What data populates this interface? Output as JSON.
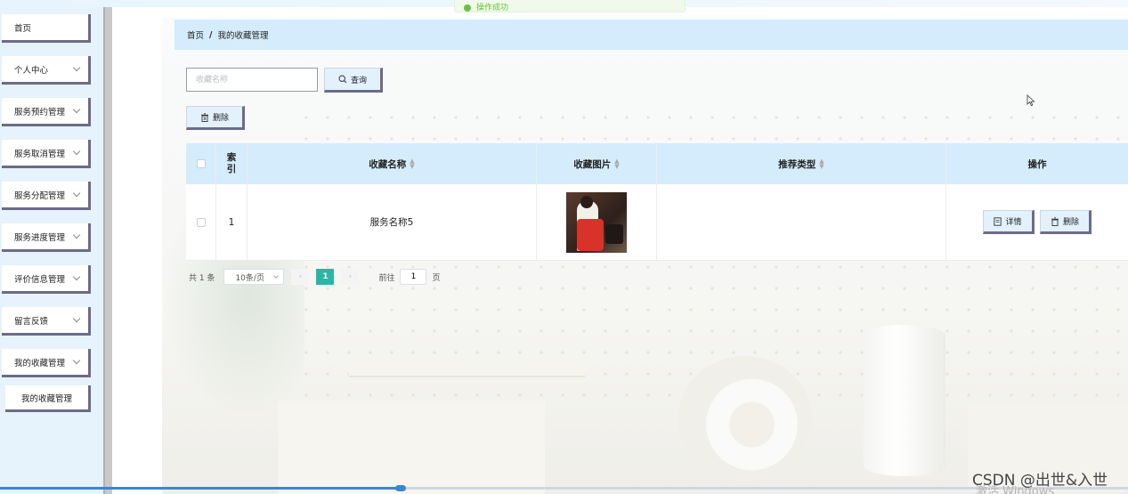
{
  "toast": {
    "text": "操作成功"
  },
  "sidebar": {
    "items": [
      {
        "label": "首页",
        "has_children": false
      },
      {
        "label": "个人中心",
        "has_children": true
      },
      {
        "label": "服务预约管理",
        "has_children": true
      },
      {
        "label": "服务取消管理",
        "has_children": true
      },
      {
        "label": "服务分配管理",
        "has_children": true
      },
      {
        "label": "服务进度管理",
        "has_children": true
      },
      {
        "label": "评价信息管理",
        "has_children": true
      },
      {
        "label": "留言反馈",
        "has_children": true
      },
      {
        "label": "我的收藏管理",
        "has_children": true
      }
    ],
    "subitem": {
      "label": "我的收藏管理"
    }
  },
  "breadcrumb": {
    "home": "首页",
    "separator": "/",
    "current": "我的收藏管理"
  },
  "search": {
    "placeholder": "收藏名称",
    "value": "",
    "button_label": "查询"
  },
  "toolbar": {
    "delete_label": "删除"
  },
  "table": {
    "columns": {
      "index_line1": "索",
      "index_line2": "引",
      "name": "收藏名称",
      "image": "收藏图片",
      "type": "推荐类型",
      "actions": "操作"
    },
    "rows": [
      {
        "index": "1",
        "name": "服务名称5",
        "type": "",
        "detail_label": "详情",
        "delete_label": "删除"
      }
    ]
  },
  "pagination": {
    "total": "共 1 条",
    "page_size": "10条/页",
    "current_page": "1",
    "goto_label": "前往",
    "goto_value": "1",
    "page_suffix": "页"
  },
  "watermark": {
    "csdn": "CSDN @出世&入世",
    "windows": "激活 Windows"
  },
  "colors": {
    "accent": "#2db5a3",
    "header_bg": "#d4ecfb",
    "button_shadow": "#6b6b8a"
  }
}
